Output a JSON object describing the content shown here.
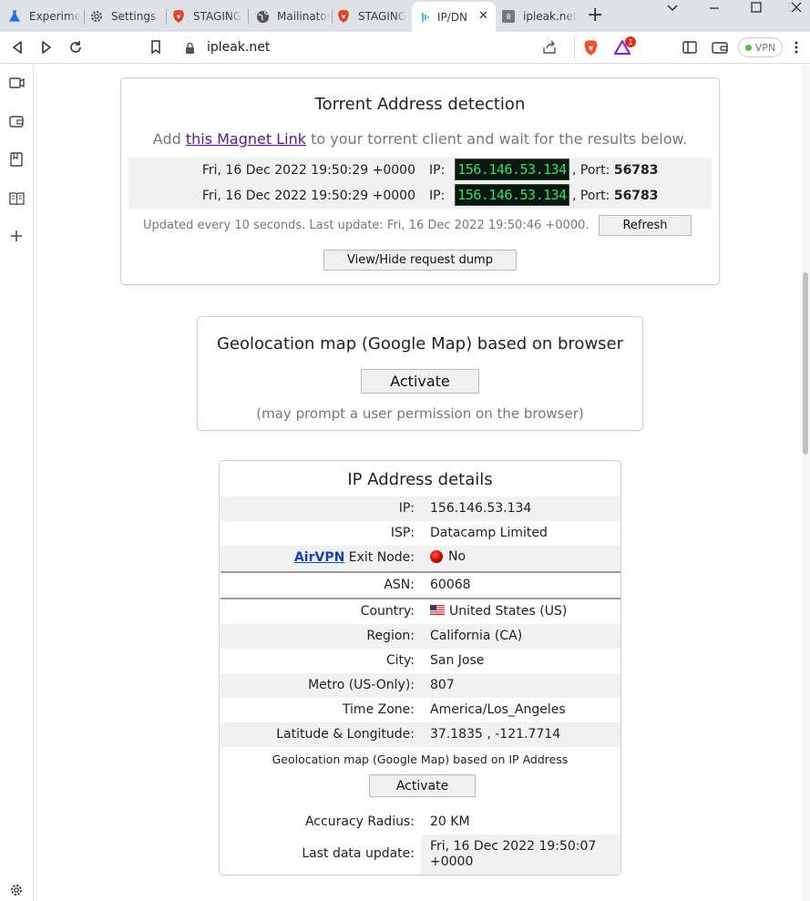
{
  "browser": {
    "tabs": [
      {
        "label": "Experimen",
        "icon": "flask-icon"
      },
      {
        "label": "Settings -",
        "icon": "gear-icon"
      },
      {
        "label": "STAGING",
        "icon": "brave-icon"
      },
      {
        "label": "Mailinator",
        "icon": "globe-icon"
      },
      {
        "label": "STAGING",
        "icon": "brave-icon"
      },
      {
        "label": "IP/DN",
        "icon": "ipleak-icon",
        "active": true
      },
      {
        "label": "ipleak.net",
        "icon": "ipleak-icon"
      }
    ],
    "url": "ipleak.net",
    "vpn_label": "VPN",
    "rewards_badge": "1"
  },
  "torrent": {
    "title": "Torrent Address detection",
    "intro_prefix": "Add ",
    "magnet_link": "this Magnet Link",
    "intro_suffix": " to your torrent client and wait for the results below.",
    "rows": [
      {
        "date": "Fri, 16 Dec 2022 19:50:29 +0000",
        "ip_label": "IP:",
        "ip": "156.146.53.134",
        "port_label": ", Port:",
        "port": "56783"
      },
      {
        "date": "Fri, 16 Dec 2022 19:50:29 +0000",
        "ip_label": "IP:",
        "ip": "156.146.53.134",
        "port_label": ", Port:",
        "port": "56783"
      }
    ],
    "update_text": "Updated every 10 seconds. Last update: Fri, 16 Dec 2022 19:50:46 +0000.",
    "refresh_label": "Refresh",
    "dump_label": "View/Hide request dump"
  },
  "geobrowser": {
    "title": "Geolocation map (Google Map) based on browser",
    "activate_label": "Activate",
    "note": "(may prompt a user permission on the browser)"
  },
  "ipdetails": {
    "title": "IP Address details",
    "ip_label": "IP:",
    "ip": "156.146.53.134",
    "isp_label": "ISP:",
    "isp": "Datacamp Limited",
    "airvpn_link": "AirVPN",
    "exit_label": " Exit Node:",
    "exit_value": "No",
    "asn_label": "ASN:",
    "asn": "60068",
    "country_label": "Country:",
    "country": "United States (US)",
    "region_label": "Region:",
    "region": "California (CA)",
    "city_label": "City:",
    "city": "San Jose",
    "metro_label": "Metro (US-Only):",
    "metro": "807",
    "tz_label": "Time Zone:",
    "tz": "America/Los_Angeles",
    "latlong_label": "Latitude & Longitude:",
    "latlong": "37.1835 , -121.7714",
    "map_caption": "Geolocation map (Google Map) based on IP Address",
    "activate_label": "Activate",
    "accuracy_label": "Accuracy Radius:",
    "accuracy": "20 KM",
    "lastupdate_label": "Last data update:",
    "lastupdate_line1": "Fri, 16 Dec 2022 19:50:07",
    "lastupdate_line2": "+0000"
  },
  "colors": {
    "ip_badge_bg": "#0b1611",
    "ip_badge_text": "#2de068",
    "link": "#551a8b",
    "airvpn": "#1a3fa8",
    "status_red": "#d01010"
  }
}
